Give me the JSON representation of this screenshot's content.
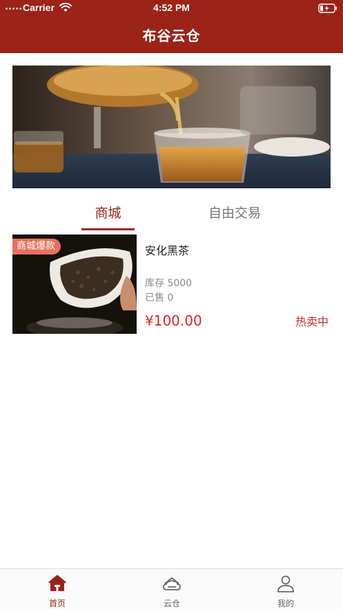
{
  "status_bar": {
    "carrier": "Carrier",
    "time": "4:52 PM",
    "icons": [
      "signal-dots-icon",
      "wifi-icon",
      "battery-charging-icon"
    ]
  },
  "nav": {
    "title": "布谷云仓"
  },
  "banner": {
    "image": "tea-pouring-into-glass-cup-photo"
  },
  "tabs": [
    {
      "label": "商城",
      "active": true
    },
    {
      "label": "自由交易",
      "active": false
    }
  ],
  "products": [
    {
      "badge": "商城爆款",
      "name": "安化黑茶",
      "stock": "库存 5000",
      "sold": "已售 0",
      "price": "¥100.00",
      "status": "热卖中",
      "image": "black-tea-leaves-in-scoop-photo"
    }
  ],
  "tabbar": [
    {
      "label": "首页",
      "icon": "home-icon",
      "active": true
    },
    {
      "label": "云仓",
      "icon": "cloud-warehouse-icon",
      "active": false
    },
    {
      "label": "我的",
      "icon": "user-icon",
      "active": false
    }
  ],
  "colors": {
    "brand": "#9b2318",
    "price": "#d62a25",
    "badge": "#e8705e",
    "muted": "#888888"
  }
}
